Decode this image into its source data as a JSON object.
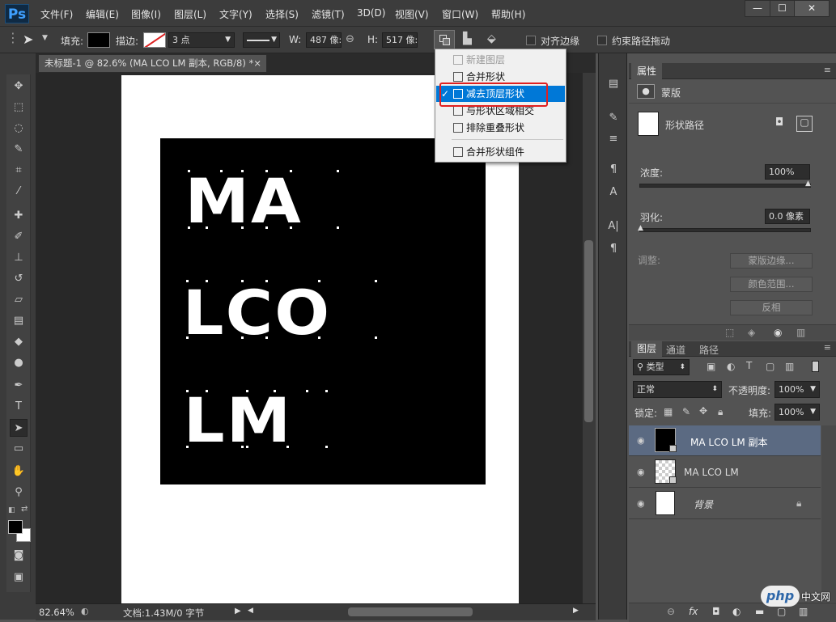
{
  "app": {
    "logo": "Ps"
  },
  "menu": [
    "文件(F)",
    "编辑(E)",
    "图像(I)",
    "图层(L)",
    "文字(Y)",
    "选择(S)",
    "滤镜(T)",
    "3D(D)",
    "视图(V)",
    "窗口(W)",
    "帮助(H)"
  ],
  "window_controls": {
    "minimize": "—",
    "maximize": "☐",
    "close": "✕"
  },
  "options": {
    "fill_label": "填充:",
    "stroke_label": "描边:",
    "stroke_width": "3 点",
    "w_label": "W:",
    "w_value": "487 像:",
    "h_label": "H:",
    "h_value": "517 像:",
    "align_edges": "对齐边缘",
    "constrain_path": "约束路径拖动"
  },
  "document": {
    "tab_title": "未标题-1 @ 82.6% (MA LCO LM 副本, RGB/8) *",
    "close": "×",
    "text_lines": [
      "MA",
      "LCO",
      "LM"
    ]
  },
  "status": {
    "zoom": "82.64%",
    "doc": "文档:1.43M/0 字节"
  },
  "dropdown": {
    "items": [
      "新建图层",
      "合并形状",
      "减去顶层形状",
      "与形状区域相交",
      "排除重叠形状",
      "合并形状组件"
    ],
    "selected_index": 2,
    "disabled_index": 0,
    "check": "✓"
  },
  "properties": {
    "tab": "属性",
    "mask_label": "蒙版",
    "shape_label": "形状路径",
    "density_label": "浓度:",
    "density_value": "100%",
    "feather_label": "羽化:",
    "feather_value": "0.0 像素",
    "adjust_label": "调整:",
    "btn_mask_edge": "蒙版边缘...",
    "btn_color_range": "颜色范围...",
    "btn_invert": "反相"
  },
  "layers": {
    "tabs": [
      "图层",
      "通道",
      "路径"
    ],
    "filter_type": "类型",
    "blend_mode": "正常",
    "opacity_label": "不透明度:",
    "opacity_value": "100%",
    "lock_label": "锁定:",
    "fill_label": "填充:",
    "fill_value": "100%",
    "rows": [
      {
        "name": "MA LCO LM 副本",
        "selected": true
      },
      {
        "name": "MA LCO LM",
        "selected": false
      },
      {
        "name": "背景",
        "selected": false
      }
    ]
  },
  "watermark": "php 中文网",
  "colors": {
    "accent": "#0078d7",
    "highlight_border": "#e02020",
    "selected_row": "#5b6a82"
  }
}
